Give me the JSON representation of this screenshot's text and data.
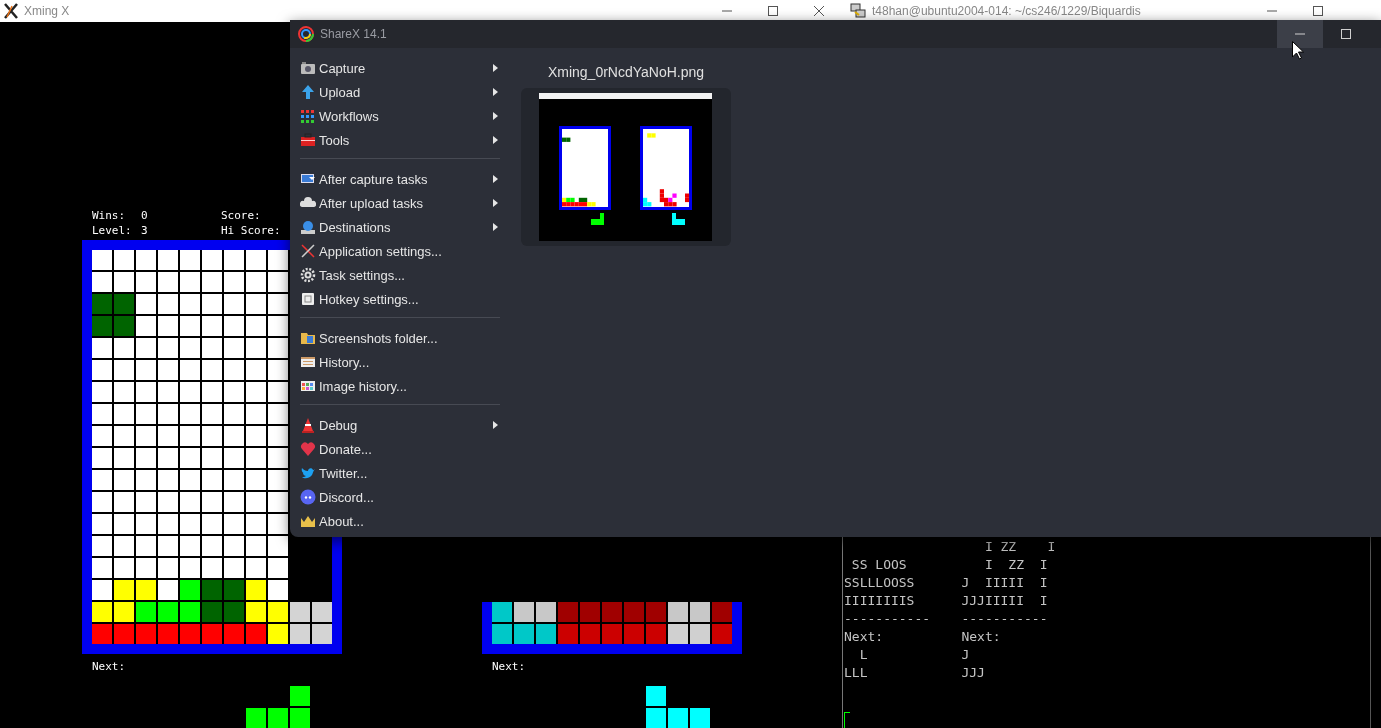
{
  "xming_window": {
    "title": "Xming X",
    "controls": [
      {
        "kind": "minimize"
      },
      {
        "kind": "maximize"
      },
      {
        "kind": "close"
      }
    ],
    "players": [
      {
        "stats": [
          {
            "label": "Wins:",
            "value": "0",
            "score_label": "Score:"
          },
          {
            "label": "Level:",
            "value": "3",
            "score_label": "Hi Score:"
          }
        ],
        "board": [
          {
            "cells": [
              {
                "color": "#ffffff"
              },
              {
                "color": "#ffffff"
              },
              {
                "color": "#ffffff"
              },
              {
                "color": "#ffffff"
              },
              {
                "color": "#ffffff"
              },
              {
                "color": "#ffffff"
              },
              {
                "color": "#ffffff"
              },
              {
                "color": "#ffffff"
              },
              {
                "color": "#ffffff"
              }
            ]
          },
          {
            "cells": [
              {
                "color": "#ffffff"
              },
              {
                "color": "#ffffff"
              },
              {
                "color": "#ffffff"
              },
              {
                "color": "#ffffff"
              },
              {
                "color": "#ffffff"
              },
              {
                "color": "#ffffff"
              },
              {
                "color": "#ffffff"
              },
              {
                "color": "#ffffff"
              },
              {
                "color": "#ffffff"
              }
            ]
          },
          {
            "cells": [
              {
                "color": "#006400"
              },
              {
                "color": "#006400"
              },
              {
                "color": "#ffffff"
              },
              {
                "color": "#ffffff"
              },
              {
                "color": "#ffffff"
              },
              {
                "color": "#ffffff"
              },
              {
                "color": "#ffffff"
              },
              {
                "color": "#ffffff"
              },
              {
                "color": "#ffffff"
              }
            ]
          },
          {
            "cells": [
              {
                "color": "#006400"
              },
              {
                "color": "#006400"
              },
              {
                "color": "#ffffff"
              },
              {
                "color": "#ffffff"
              },
              {
                "color": "#ffffff"
              },
              {
                "color": "#ffffff"
              },
              {
                "color": "#ffffff"
              },
              {
                "color": "#ffffff"
              },
              {
                "color": "#ffffff"
              }
            ]
          },
          {
            "cells": [
              {
                "color": "#ffffff"
              },
              {
                "color": "#ffffff"
              },
              {
                "color": "#ffffff"
              },
              {
                "color": "#ffffff"
              },
              {
                "color": "#ffffff"
              },
              {
                "color": "#ffffff"
              },
              {
                "color": "#ffffff"
              },
              {
                "color": "#ffffff"
              },
              {
                "color": "#ffffff"
              }
            ]
          },
          {
            "cells": [
              {
                "color": "#ffffff"
              },
              {
                "color": "#ffffff"
              },
              {
                "color": "#ffffff"
              },
              {
                "color": "#ffffff"
              },
              {
                "color": "#ffffff"
              },
              {
                "color": "#ffffff"
              },
              {
                "color": "#ffffff"
              },
              {
                "color": "#ffffff"
              },
              {
                "color": "#ffffff"
              }
            ]
          },
          {
            "cells": [
              {
                "color": "#ffffff"
              },
              {
                "color": "#ffffff"
              },
              {
                "color": "#ffffff"
              },
              {
                "color": "#ffffff"
              },
              {
                "color": "#ffffff"
              },
              {
                "color": "#ffffff"
              },
              {
                "color": "#ffffff"
              },
              {
                "color": "#ffffff"
              },
              {
                "color": "#ffffff"
              }
            ]
          },
          {
            "cells": [
              {
                "color": "#ffffff"
              },
              {
                "color": "#ffffff"
              },
              {
                "color": "#ffffff"
              },
              {
                "color": "#ffffff"
              },
              {
                "color": "#ffffff"
              },
              {
                "color": "#ffffff"
              },
              {
                "color": "#ffffff"
              },
              {
                "color": "#ffffff"
              },
              {
                "color": "#ffffff"
              }
            ]
          },
          {
            "cells": [
              {
                "color": "#ffffff"
              },
              {
                "color": "#ffffff"
              },
              {
                "color": "#ffffff"
              },
              {
                "color": "#ffffff"
              },
              {
                "color": "#ffffff"
              },
              {
                "color": "#ffffff"
              },
              {
                "color": "#ffffff"
              },
              {
                "color": "#ffffff"
              },
              {
                "color": "#ffffff"
              }
            ]
          },
          {
            "cells": [
              {
                "color": "#ffffff"
              },
              {
                "color": "#ffffff"
              },
              {
                "color": "#ffffff"
              },
              {
                "color": "#ffffff"
              },
              {
                "color": "#ffffff"
              },
              {
                "color": "#ffffff"
              },
              {
                "color": "#ffffff"
              },
              {
                "color": "#ffffff"
              },
              {
                "color": "#ffffff"
              }
            ]
          },
          {
            "cells": [
              {
                "color": "#ffffff"
              },
              {
                "color": "#ffffff"
              },
              {
                "color": "#ffffff"
              },
              {
                "color": "#ffffff"
              },
              {
                "color": "#ffffff"
              },
              {
                "color": "#ffffff"
              },
              {
                "color": "#ffffff"
              },
              {
                "color": "#ffffff"
              },
              {
                "color": "#ffffff"
              }
            ]
          },
          {
            "cells": [
              {
                "color": "#ffffff"
              },
              {
                "color": "#ffffff"
              },
              {
                "color": "#ffffff"
              },
              {
                "color": "#ffffff"
              },
              {
                "color": "#ffffff"
              },
              {
                "color": "#ffffff"
              },
              {
                "color": "#ffffff"
              },
              {
                "color": "#ffffff"
              },
              {
                "color": "#ffffff"
              }
            ]
          },
          {
            "cells": [
              {
                "color": "#ffffff"
              },
              {
                "color": "#ffffff"
              },
              {
                "color": "#ffffff"
              },
              {
                "color": "#ffffff"
              },
              {
                "color": "#ffffff"
              },
              {
                "color": "#ffffff"
              },
              {
                "color": "#ffffff"
              },
              {
                "color": "#ffffff"
              },
              {
                "color": "#ffffff"
              }
            ]
          },
          {
            "cells": [
              {
                "color": "#ffffff"
              },
              {
                "color": "#ffffff"
              },
              {
                "color": "#ffffff"
              },
              {
                "color": "#ffffff"
              },
              {
                "color": "#ffffff"
              },
              {
                "color": "#ffffff"
              },
              {
                "color": "#ffffff"
              },
              {
                "color": "#ffffff"
              },
              {
                "color": "#ffffff"
              }
            ]
          },
          {
            "cells": [
              {
                "color": "#ffffff"
              },
              {
                "color": "#ffffff"
              },
              {
                "color": "#ffffff"
              },
              {
                "color": "#ffffff"
              },
              {
                "color": "#ffffff"
              },
              {
                "color": "#ffffff"
              },
              {
                "color": "#ffffff"
              },
              {
                "color": "#ffffff"
              },
              {
                "color": "#ffffff"
              }
            ]
          },
          {
            "cells": [
              {
                "color": "#ffffff"
              },
              {
                "color": "#ffff00"
              },
              {
                "color": "#ffff00"
              },
              {
                "color": "#ffffff"
              },
              {
                "color": "#00ff00"
              },
              {
                "color": "#006400"
              },
              {
                "color": "#006400"
              },
              {
                "color": "#ffff00"
              },
              {
                "color": "#ffffff"
              }
            ]
          },
          {
            "cells": [
              {
                "color": "#ffff00"
              },
              {
                "color": "#ffff00"
              },
              {
                "color": "#00ff00"
              },
              {
                "color": "#00ff00"
              },
              {
                "color": "#00ff00"
              },
              {
                "color": "#006400"
              },
              {
                "color": "#006400"
              },
              {
                "color": "#ffff00"
              },
              {
                "color": "#ffff00"
              },
              {
                "color": "#d4d4d4"
              },
              {
                "color": "#d4d4d4"
              }
            ]
          },
          {
            "cells": [
              {
                "color": "#ff0000"
              },
              {
                "color": "#ff0000"
              },
              {
                "color": "#ff0000"
              },
              {
                "color": "#ff0000"
              },
              {
                "color": "#ff0000"
              },
              {
                "color": "#ff0000"
              },
              {
                "color": "#ff0000"
              },
              {
                "color": "#ff0000"
              },
              {
                "color": "#ffff00"
              },
              {
                "color": "#d4d4d4"
              },
              {
                "color": "#d4d4d4"
              }
            ]
          }
        ],
        "next_label": "Next:",
        "next_piece": {
          "color": "#00ff00",
          "rows": [
            {
              "cells": [
                {
                  "filled": false
                },
                {
                  "filled": false
                },
                {
                  "filled": true
                }
              ]
            },
            {
              "cells": [
                {
                  "filled": true
                },
                {
                  "filled": true
                },
                {
                  "filled": true
                }
              ]
            }
          ]
        }
      },
      {
        "board": [
          {
            "cells": [
              {
                "color": "#00c8c8"
              },
              {
                "color": "#c8c8c8"
              },
              {
                "color": "#c8c8c8"
              },
              {
                "color": "#a00000"
              },
              {
                "color": "#a00000"
              },
              {
                "color": "#a00000"
              },
              {
                "color": "#a00000"
              },
              {
                "color": "#a00000"
              },
              {
                "color": "#c8c8c8"
              },
              {
                "color": "#c8c8c8"
              },
              {
                "color": "#a00000"
              }
            ]
          },
          {
            "cells": [
              {
                "color": "#00c8c8"
              },
              {
                "color": "#00c8c8"
              },
              {
                "color": "#00c8c8"
              },
              {
                "color": "#cc0000"
              },
              {
                "color": "#cc0000"
              },
              {
                "color": "#cc0000"
              },
              {
                "color": "#cc0000"
              },
              {
                "color": "#cc0000"
              },
              {
                "color": "#d0d0d0"
              },
              {
                "color": "#d0d0d0"
              },
              {
                "color": "#cc0000"
              }
            ]
          }
        ],
        "next_label": "Next:",
        "next_piece": {
          "color": "#00ffff",
          "rows": [
            {
              "cells": [
                {
                  "filled": true
                },
                {
                  "filled": false
                },
                {
                  "filled": false
                }
              ]
            },
            {
              "cells": [
                {
                  "filled": true
                },
                {
                  "filled": true
                },
                {
                  "filled": true
                }
              ]
            }
          ]
        }
      }
    ]
  },
  "terminal_window": {
    "title": "t48han@ubuntu2004-014: ~/cs246/1229/Biquardis",
    "controls": [
      {
        "kind": "minimize"
      },
      {
        "kind": "maximize"
      }
    ],
    "lines": [
      "                  I ZZ    I",
      " SS LOOS          I  ZZ  I",
      "SSLLLOOSS      J  IIIII  I",
      "IIIIIIIIS      JJJIIIII  I",
      "-----------    -----------",
      "Next:          Next:",
      "  L            J",
      "LLL            JJJ"
    ]
  },
  "sharex_window": {
    "title": "ShareX 14.1",
    "controls": [
      {
        "kind": "minimize",
        "hovered": true
      },
      {
        "kind": "maximize",
        "hovered": false
      }
    ],
    "menu_groups": [
      [
        {
          "label": "Capture",
          "submenu": true
        },
        {
          "label": "Upload",
          "submenu": true
        },
        {
          "label": "Workflows",
          "submenu": true
        },
        {
          "label": "Tools",
          "submenu": true
        }
      ],
      [
        {
          "label": "After capture tasks",
          "submenu": true
        },
        {
          "label": "After upload tasks",
          "submenu": true
        },
        {
          "label": "Destinations",
          "submenu": true
        },
        {
          "label": "Application settings...",
          "submenu": false
        },
        {
          "label": "Task settings...",
          "submenu": false
        },
        {
          "label": "Hotkey settings...",
          "submenu": false
        }
      ],
      [
        {
          "label": "Screenshots folder...",
          "submenu": false
        },
        {
          "label": "History...",
          "submenu": false
        },
        {
          "label": "Image history...",
          "submenu": false
        }
      ],
      [
        {
          "label": "Debug",
          "submenu": true
        },
        {
          "label": "Donate...",
          "submenu": false
        },
        {
          "label": "Twitter...",
          "submenu": false
        },
        {
          "label": "Discord...",
          "submenu": false
        },
        {
          "label": "About...",
          "submenu": false
        }
      ]
    ],
    "file": {
      "name": "Xming_0rNcdYaNoH.png"
    }
  }
}
